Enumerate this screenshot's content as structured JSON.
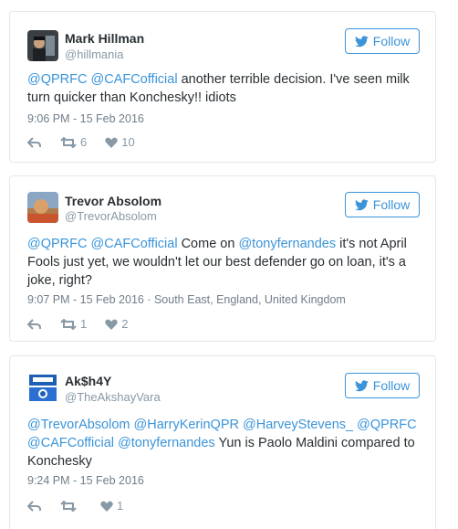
{
  "follow_label": "Follow",
  "tweets": [
    {
      "name": "Mark Hillman",
      "handle": "@hillmania",
      "text_parts": {
        "m1": "@QPRFC",
        "m2": "@CAFCofficial",
        "t1": " another terrible decision. I've seen milk",
        "t2": "turn quicker than Konchesky!! idiots"
      },
      "time": "9:06 PM - 15 Feb 2016",
      "retweets": "6",
      "likes": "10"
    },
    {
      "name": "Trevor Absolom",
      "handle": "@TrevorAbsolom",
      "text_parts": {
        "m1": "@QPRFC",
        "m2": "@CAFCofficial",
        "t1": " Come on ",
        "m3": "@tonyfernandes",
        "t2": " it's not April",
        "t3": "Fools just yet, we wouldn't let our best defender go on loan, it's a",
        "t4": "joke, right?"
      },
      "time": "9:07 PM - 15 Feb 2016",
      "location": " · South East, England, United Kingdom",
      "retweets": "1",
      "likes": "2"
    },
    {
      "name": "Ak$h4Y",
      "handle": "@TheAkshayVara",
      "text_parts": {
        "m1": "@TrevorAbsolom",
        "m2": "@HarryKerinQPR",
        "m3": "@HarveyStevens_",
        "m4": "@QPRFC",
        "m5": "@CAFCofficial",
        "m6": "@tonyfernandes",
        "t1": " Yun is Paolo Maldini compared to",
        "t2": "Konchesky"
      },
      "time": "9:24 PM - 15 Feb 2016",
      "retweets": "",
      "likes": "1"
    }
  ],
  "colors": {
    "link": "#3b94d9",
    "text": "#292f33",
    "muted": "#8899a6",
    "border": "#e1e8ed"
  }
}
